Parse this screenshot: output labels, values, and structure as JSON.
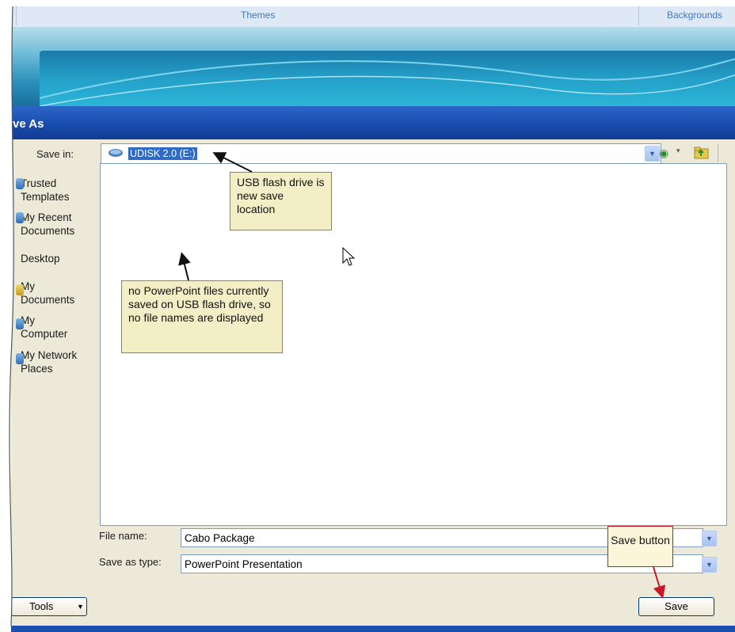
{
  "ribbon": {
    "tabs": [
      "Themes",
      "Backgrounds"
    ]
  },
  "dialog": {
    "title": "ve As",
    "save_in_label": "Save in:",
    "save_in_value": "UDISK 2.0 (E:)",
    "places": [
      {
        "label": "Trusted Templates"
      },
      {
        "label": "My Recent Documents"
      },
      {
        "label": "Desktop"
      },
      {
        "label": "My Documents"
      },
      {
        "label": "My Computer"
      },
      {
        "label": "My Network Places"
      }
    ],
    "file_name_label": "File name:",
    "file_name_value": "Cabo Package",
    "save_as_type_label": "Save as type:",
    "save_as_type_value": "PowerPoint Presentation",
    "tools_label": "Tools",
    "save_button_label": "Save"
  },
  "callouts": {
    "usb": "USB flash drive is new save location",
    "nofiles": "no PowerPoint files currently saved on USB flash drive, so no file names are displayed",
    "save_button": "Save button"
  },
  "colors": {
    "titlebar": "#1a4fb0",
    "dialog_bg": "#ece9d8",
    "callout_red_border": "#c8182a"
  }
}
